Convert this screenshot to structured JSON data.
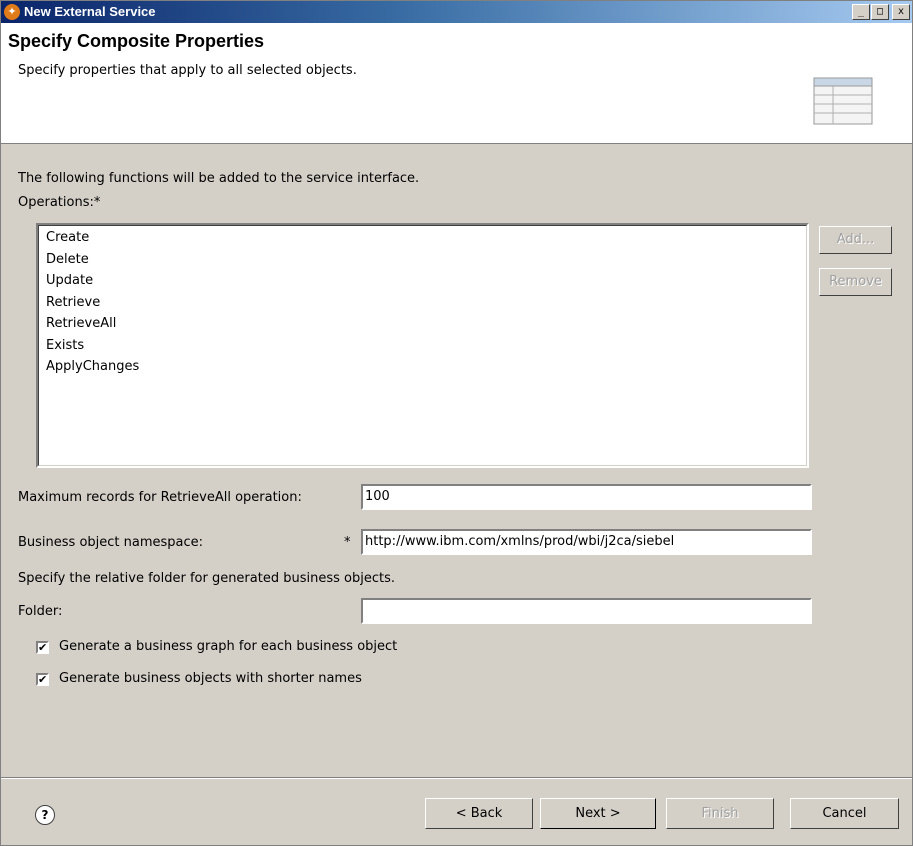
{
  "window": {
    "title": "New External Service",
    "controls": [
      "_",
      "□",
      "x"
    ]
  },
  "header": {
    "title": "Specify Composite Properties",
    "subtitle": "Specify properties that apply to all selected objects."
  },
  "intro_text": "The following functions will be added to the service interface.",
  "operations": {
    "label": "Operations:*",
    "items": [
      "Create",
      "Delete",
      "Update",
      "Retrieve",
      "RetrieveAll",
      "Exists",
      "ApplyChanges"
    ],
    "add_label": "Add...",
    "remove_label": "Remove"
  },
  "max_records": {
    "label": "Maximum records for RetrieveAll operation:",
    "value": "100"
  },
  "namespace": {
    "label": "Business object namespace:",
    "required_marker": "*",
    "value": "http://www.ibm.com/xmlns/prod/wbi/j2ca/siebel"
  },
  "folder_hint": "Specify the relative folder for generated business objects.",
  "folder": {
    "label": "Folder:",
    "value": ""
  },
  "checkboxes": [
    {
      "label": "Generate a business graph for each business object",
      "checked": true
    },
    {
      "label": "Generate business objects with shorter names",
      "checked": true
    }
  ],
  "footer": {
    "help_icon": "question-icon",
    "back_label": "< Back",
    "next_label": "Next >",
    "finish_label": "Finish",
    "cancel_label": "Cancel"
  },
  "colors": {
    "titlebar_start": "#0a246a",
    "titlebar_end": "#a6caf0",
    "dialog_bg": "#d4d0c8"
  }
}
